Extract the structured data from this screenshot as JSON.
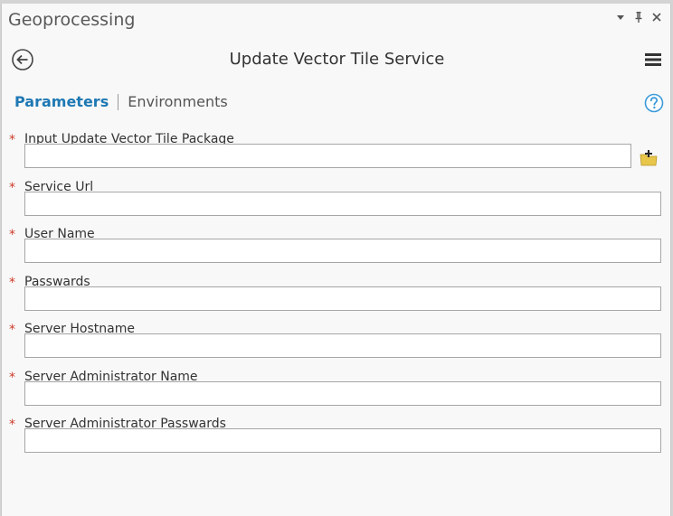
{
  "pane": {
    "title": "Geoprocessing",
    "options_icon": "triangle-down-icon",
    "pin_icon": "pin-icon",
    "close_icon": "close-icon"
  },
  "tool": {
    "title": "Update Vector Tile Service",
    "back_icon": "back-arrow-icon",
    "menu_icon": "hamburger-menu-icon"
  },
  "tabs": [
    {
      "label": "Parameters",
      "active": true
    },
    {
      "label": "Environments",
      "active": false
    }
  ],
  "help_icon": "help-icon",
  "required_marker": "*",
  "parameters": [
    {
      "label": "Input Update Vector Tile Package",
      "value": "",
      "browse_icon": "browse-folder-icon"
    },
    {
      "label": "Service Url",
      "value": ""
    },
    {
      "label": "User Name",
      "value": ""
    },
    {
      "label": "Passwards",
      "value": ""
    },
    {
      "label": "Server Hostname",
      "value": ""
    },
    {
      "label": "Server Administrator Name",
      "value": ""
    },
    {
      "label": "Server Administrator Passwards",
      "value": ""
    }
  ],
  "colors": {
    "active_tab": "#1e78b4",
    "required_marker": "#cc3b2b",
    "help_icon": "#3a9ad9",
    "folder": "#e8c64a"
  }
}
